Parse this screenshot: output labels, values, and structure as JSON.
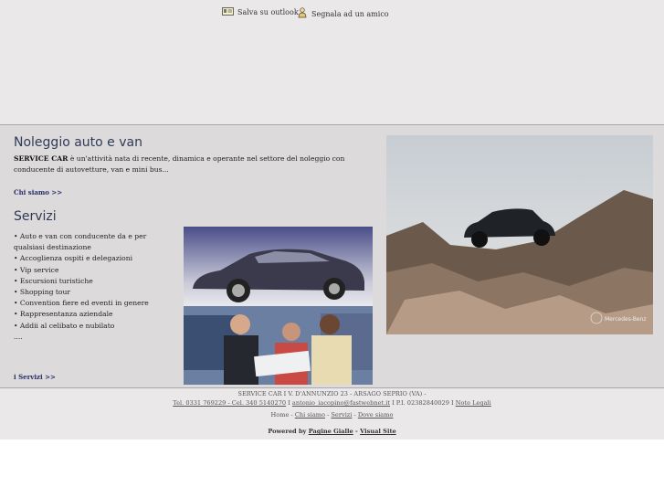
{
  "top_links": {
    "save_outlook": "Salva su outlook",
    "report_friend": "Segnala ad un amico"
  },
  "intro": {
    "title": "Noleggio auto e van",
    "brand": "SERVICE CAR",
    "text": " è un'attività nata di recente, dinamica e operante nel settore del noleggio con conducente di autovetture, van e mini bus...",
    "more_link": "Chi siamo >>"
  },
  "services": {
    "title": "Servizi",
    "items": [
      "• Auto e van con conducente da e per qualsiasi destinazione",
      "• Accoglienza ospiti e delegazioni",
      "• Vip service",
      "• Escursioni turistiche",
      "• Shopping tour",
      "• Convention fiere ed eventi in genere",
      "• Rappresentanza aziendale",
      "• Addii al celibato e nubilato",
      "...."
    ],
    "more_link": "i Servizi >>"
  },
  "photo_watermark": "Mercedes-Benz",
  "footer": {
    "address": "SERVICE CAR I V. D'ANNUNZIO 23 - ARSAGO SEPRIO (VA) -",
    "contacts": "Tel. 0331 769229 - Cel. 340 5140270",
    "email": "antonio_iacopino@fastwebnet.it",
    "vat": " I P.I. 02382840029 I ",
    "legal": "Note Legali",
    "nav_home": "Home",
    "nav_about": "Chi siamo",
    "nav_services": "Servizi",
    "nav_where": "Dove siamo",
    "powered_by": "Powered by",
    "pg": "Pagine Gialle",
    "vs": "Visual Site"
  }
}
